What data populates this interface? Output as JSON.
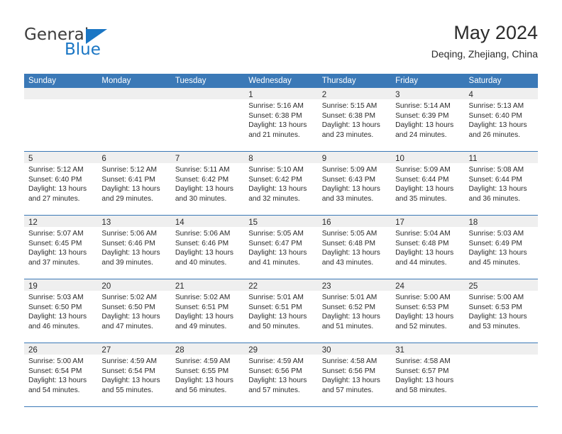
{
  "brand": {
    "name_top": "General",
    "name_bottom": "Blue",
    "accent_color": "#1a76c4"
  },
  "header": {
    "title": "May 2024",
    "subtitle": "Deqing, Zhejiang, China"
  },
  "theme": {
    "header_blue": "#3b79b7",
    "day_band_gray": "#efefef",
    "text_color": "#2b2b2b"
  },
  "calendar": {
    "weekdays": [
      "Sunday",
      "Monday",
      "Tuesday",
      "Wednesday",
      "Thursday",
      "Friday",
      "Saturday"
    ],
    "weeks": [
      [
        {
          "day": "",
          "lines": []
        },
        {
          "day": "",
          "lines": []
        },
        {
          "day": "",
          "lines": []
        },
        {
          "day": "1",
          "lines": [
            "Sunrise: 5:16 AM",
            "Sunset: 6:38 PM",
            "Daylight: 13 hours",
            "and 21 minutes."
          ]
        },
        {
          "day": "2",
          "lines": [
            "Sunrise: 5:15 AM",
            "Sunset: 6:38 PM",
            "Daylight: 13 hours",
            "and 23 minutes."
          ]
        },
        {
          "day": "3",
          "lines": [
            "Sunrise: 5:14 AM",
            "Sunset: 6:39 PM",
            "Daylight: 13 hours",
            "and 24 minutes."
          ]
        },
        {
          "day": "4",
          "lines": [
            "Sunrise: 5:13 AM",
            "Sunset: 6:40 PM",
            "Daylight: 13 hours",
            "and 26 minutes."
          ]
        }
      ],
      [
        {
          "day": "5",
          "lines": [
            "Sunrise: 5:12 AM",
            "Sunset: 6:40 PM",
            "Daylight: 13 hours",
            "and 27 minutes."
          ]
        },
        {
          "day": "6",
          "lines": [
            "Sunrise: 5:12 AM",
            "Sunset: 6:41 PM",
            "Daylight: 13 hours",
            "and 29 minutes."
          ]
        },
        {
          "day": "7",
          "lines": [
            "Sunrise: 5:11 AM",
            "Sunset: 6:42 PM",
            "Daylight: 13 hours",
            "and 30 minutes."
          ]
        },
        {
          "day": "8",
          "lines": [
            "Sunrise: 5:10 AM",
            "Sunset: 6:42 PM",
            "Daylight: 13 hours",
            "and 32 minutes."
          ]
        },
        {
          "day": "9",
          "lines": [
            "Sunrise: 5:09 AM",
            "Sunset: 6:43 PM",
            "Daylight: 13 hours",
            "and 33 minutes."
          ]
        },
        {
          "day": "10",
          "lines": [
            "Sunrise: 5:09 AM",
            "Sunset: 6:44 PM",
            "Daylight: 13 hours",
            "and 35 minutes."
          ]
        },
        {
          "day": "11",
          "lines": [
            "Sunrise: 5:08 AM",
            "Sunset: 6:44 PM",
            "Daylight: 13 hours",
            "and 36 minutes."
          ]
        }
      ],
      [
        {
          "day": "12",
          "lines": [
            "Sunrise: 5:07 AM",
            "Sunset: 6:45 PM",
            "Daylight: 13 hours",
            "and 37 minutes."
          ]
        },
        {
          "day": "13",
          "lines": [
            "Sunrise: 5:06 AM",
            "Sunset: 6:46 PM",
            "Daylight: 13 hours",
            "and 39 minutes."
          ]
        },
        {
          "day": "14",
          "lines": [
            "Sunrise: 5:06 AM",
            "Sunset: 6:46 PM",
            "Daylight: 13 hours",
            "and 40 minutes."
          ]
        },
        {
          "day": "15",
          "lines": [
            "Sunrise: 5:05 AM",
            "Sunset: 6:47 PM",
            "Daylight: 13 hours",
            "and 41 minutes."
          ]
        },
        {
          "day": "16",
          "lines": [
            "Sunrise: 5:05 AM",
            "Sunset: 6:48 PM",
            "Daylight: 13 hours",
            "and 43 minutes."
          ]
        },
        {
          "day": "17",
          "lines": [
            "Sunrise: 5:04 AM",
            "Sunset: 6:48 PM",
            "Daylight: 13 hours",
            "and 44 minutes."
          ]
        },
        {
          "day": "18",
          "lines": [
            "Sunrise: 5:03 AM",
            "Sunset: 6:49 PM",
            "Daylight: 13 hours",
            "and 45 minutes."
          ]
        }
      ],
      [
        {
          "day": "19",
          "lines": [
            "Sunrise: 5:03 AM",
            "Sunset: 6:50 PM",
            "Daylight: 13 hours",
            "and 46 minutes."
          ]
        },
        {
          "day": "20",
          "lines": [
            "Sunrise: 5:02 AM",
            "Sunset: 6:50 PM",
            "Daylight: 13 hours",
            "and 47 minutes."
          ]
        },
        {
          "day": "21",
          "lines": [
            "Sunrise: 5:02 AM",
            "Sunset: 6:51 PM",
            "Daylight: 13 hours",
            "and 49 minutes."
          ]
        },
        {
          "day": "22",
          "lines": [
            "Sunrise: 5:01 AM",
            "Sunset: 6:51 PM",
            "Daylight: 13 hours",
            "and 50 minutes."
          ]
        },
        {
          "day": "23",
          "lines": [
            "Sunrise: 5:01 AM",
            "Sunset: 6:52 PM",
            "Daylight: 13 hours",
            "and 51 minutes."
          ]
        },
        {
          "day": "24",
          "lines": [
            "Sunrise: 5:00 AM",
            "Sunset: 6:53 PM",
            "Daylight: 13 hours",
            "and 52 minutes."
          ]
        },
        {
          "day": "25",
          "lines": [
            "Sunrise: 5:00 AM",
            "Sunset: 6:53 PM",
            "Daylight: 13 hours",
            "and 53 minutes."
          ]
        }
      ],
      [
        {
          "day": "26",
          "lines": [
            "Sunrise: 5:00 AM",
            "Sunset: 6:54 PM",
            "Daylight: 13 hours",
            "and 54 minutes."
          ]
        },
        {
          "day": "27",
          "lines": [
            "Sunrise: 4:59 AM",
            "Sunset: 6:54 PM",
            "Daylight: 13 hours",
            "and 55 minutes."
          ]
        },
        {
          "day": "28",
          "lines": [
            "Sunrise: 4:59 AM",
            "Sunset: 6:55 PM",
            "Daylight: 13 hours",
            "and 56 minutes."
          ]
        },
        {
          "day": "29",
          "lines": [
            "Sunrise: 4:59 AM",
            "Sunset: 6:56 PM",
            "Daylight: 13 hours",
            "and 57 minutes."
          ]
        },
        {
          "day": "30",
          "lines": [
            "Sunrise: 4:58 AM",
            "Sunset: 6:56 PM",
            "Daylight: 13 hours",
            "and 57 minutes."
          ]
        },
        {
          "day": "31",
          "lines": [
            "Sunrise: 4:58 AM",
            "Sunset: 6:57 PM",
            "Daylight: 13 hours",
            "and 58 minutes."
          ]
        },
        {
          "day": "",
          "lines": []
        }
      ]
    ]
  }
}
